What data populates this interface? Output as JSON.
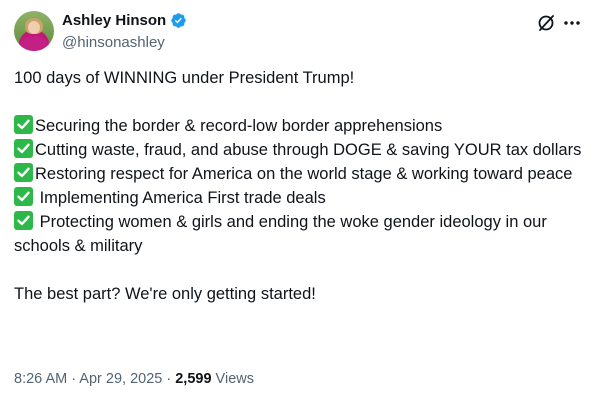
{
  "author": {
    "name": "Ashley Hinson",
    "handle": "@hinsonashley"
  },
  "tweet": {
    "intro": "100 days of WINNING under President Trump!",
    "points": [
      "Securing the border & record-low border apprehensions",
      "Cutting waste, fraud, and abuse through DOGE & saving YOUR tax dollars",
      "Restoring respect for America on the world stage & working toward peace",
      " Implementing America First trade deals",
      " Protecting women & girls and ending the woke gender ideology in our schools & military"
    ],
    "outro": "The best part? We're only getting started!"
  },
  "meta": {
    "time": "8:26 AM",
    "sep1": " · ",
    "date": "Apr 29, 2025",
    "sep2": " · ",
    "views_count": "2,599",
    "views_label": " Views"
  },
  "colors": {
    "verified_badge": "#1d9bf0",
    "check_emoji": "#2fb84a",
    "muted_text": "#536471"
  },
  "icons": [
    "verified-badge-icon",
    "grok-icon",
    "more-icon",
    "check-mark-icon"
  ]
}
